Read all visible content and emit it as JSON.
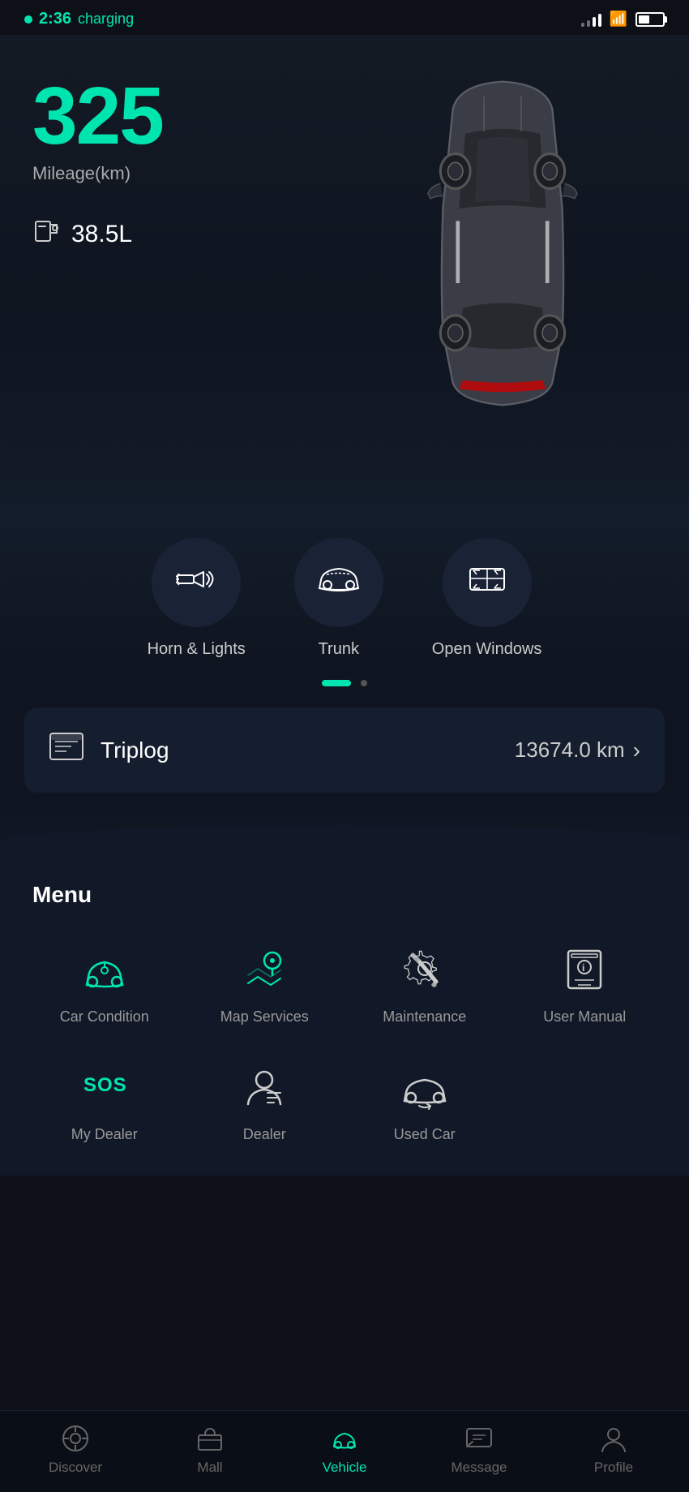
{
  "statusBar": {
    "time": "2:36",
    "charging": "charging"
  },
  "hero": {
    "mileage": "325",
    "mileageLabel": "Mileage(km)",
    "fuelAmount": "38.5L"
  },
  "quickActions": [
    {
      "id": "horn-lights",
      "label": "Horn & Lights"
    },
    {
      "id": "trunk",
      "label": "Trunk"
    },
    {
      "id": "open-windows",
      "label": "Open Windows"
    }
  ],
  "pagination": {
    "activeDot": 0,
    "totalDots": 2
  },
  "triplog": {
    "label": "Triplog",
    "value": "13674.0 km"
  },
  "menu": {
    "title": "Menu",
    "row1": [
      {
        "id": "car-condition",
        "label": "Car Condition",
        "iconColor": "teal"
      },
      {
        "id": "map-services",
        "label": "Map Services",
        "iconColor": "teal"
      },
      {
        "id": "maintenance",
        "label": "Maintenance",
        "iconColor": "white"
      },
      {
        "id": "user-manual",
        "label": "User Manual",
        "iconColor": "white"
      }
    ],
    "row2": [
      {
        "id": "my-dealer",
        "label": "My Dealer",
        "iconColor": "teal"
      },
      {
        "id": "dealer",
        "label": "Dealer",
        "iconColor": "white"
      },
      {
        "id": "used-car",
        "label": "Used Car",
        "iconColor": "white"
      },
      {
        "id": "empty",
        "label": "",
        "iconColor": "none"
      }
    ]
  },
  "bottomNav": [
    {
      "id": "discover",
      "label": "Discover",
      "active": false
    },
    {
      "id": "mall",
      "label": "Mall",
      "active": false
    },
    {
      "id": "vehicle",
      "label": "Vehicle",
      "active": true
    },
    {
      "id": "message",
      "label": "Message",
      "active": false
    },
    {
      "id": "profile",
      "label": "Profile",
      "active": false
    }
  ]
}
